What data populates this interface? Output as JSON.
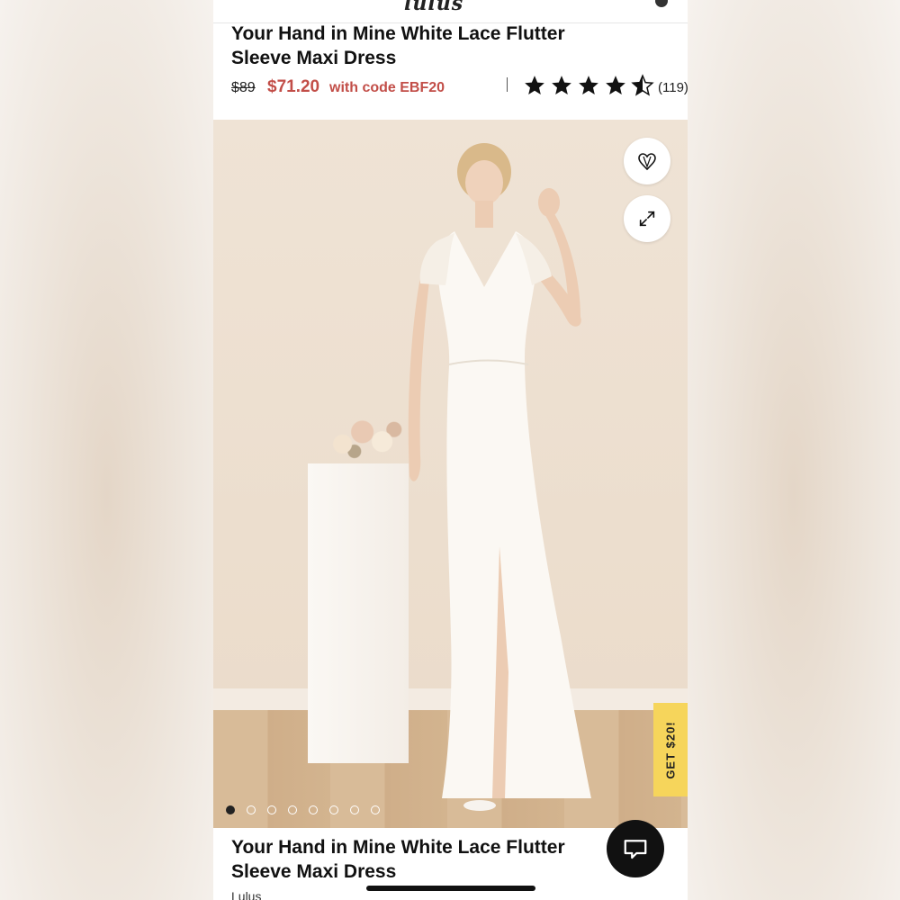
{
  "header": {
    "logo_text": "lulus"
  },
  "product": {
    "title_line1": "Your Hand in Mine White Lace Flutter",
    "title_line2": "Sleeve Maxi Dress",
    "original_price": "$89",
    "sale_price": "$71.20",
    "promo_text": "with code EBF20",
    "rating": 4.5,
    "rating_max": 5,
    "review_count": "(119)",
    "brand": "Lulus"
  },
  "gallery": {
    "promo_tab_label": "GET $20!",
    "image_count": 8,
    "active_index": 0,
    "icons": {
      "favorite": "heart-icon",
      "expand": "expand-icon",
      "chat": "chat-icon"
    }
  },
  "colors": {
    "sale": "#c24e48",
    "promo_tab": "#f6d55b",
    "star": "#111111"
  }
}
